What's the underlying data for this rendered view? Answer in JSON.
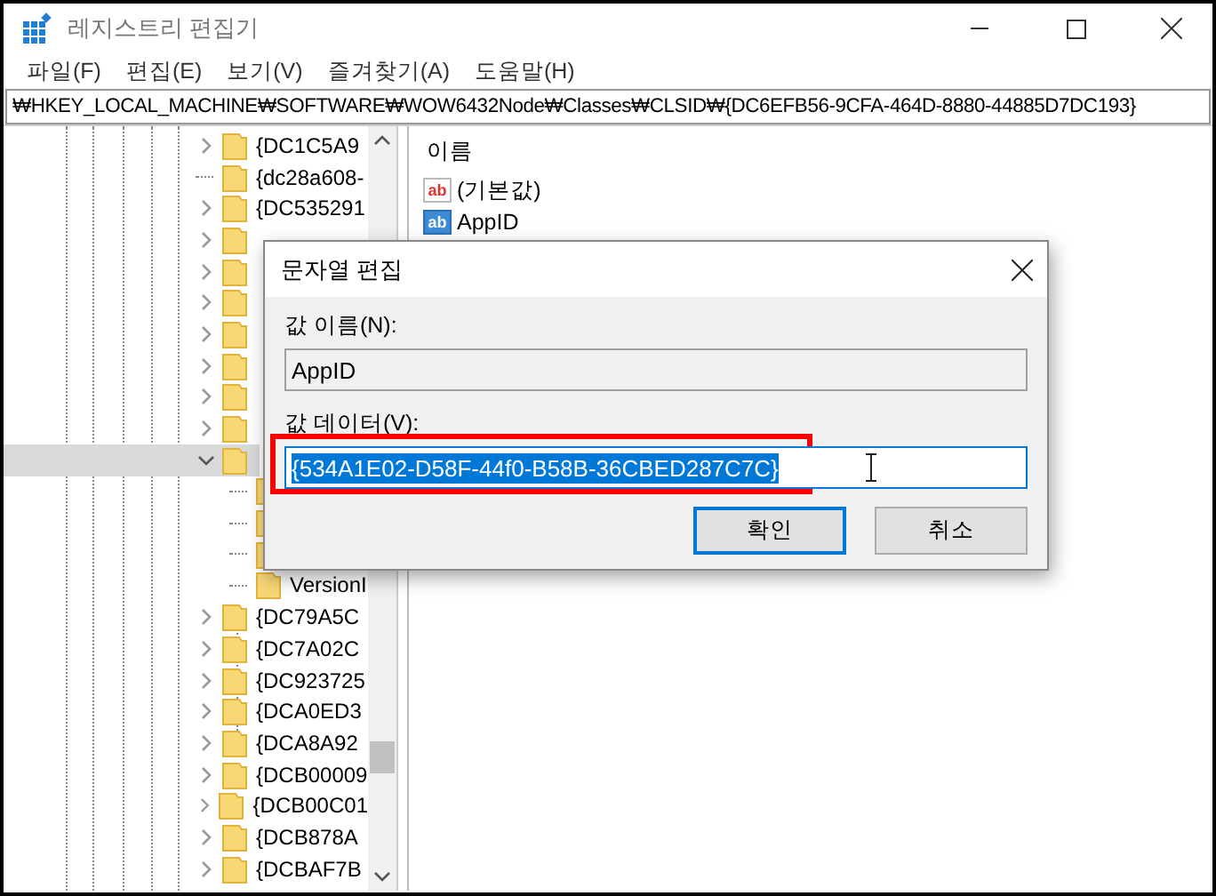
{
  "window": {
    "title": "레지스트리 편집기"
  },
  "menu": [
    "파일(F)",
    "편집(E)",
    "보기(V)",
    "즐겨찾기(A)",
    "도움말(H)"
  ],
  "address": "₩HKEY_LOCAL_MACHINE₩SOFTWARE₩WOW6432Node₩Classes₩CLSID₩{DC6EFB56-9CFA-464D-8880-44885D7DC193}",
  "tree": [
    {
      "label": "{DC1C5A9",
      "has_children": true,
      "expanded": false,
      "selected": false
    },
    {
      "label": "{dc28a608-",
      "has_children": false,
      "selected": false
    },
    {
      "label": "{DC535291",
      "has_children": true,
      "expanded": false,
      "selected": false
    },
    {
      "has_children": true,
      "expanded": false,
      "selected": false
    },
    {
      "has_children": true,
      "expanded": false,
      "selected": false
    },
    {
      "has_children": true,
      "expanded": false,
      "selected": false
    },
    {
      "has_children": true,
      "expanded": false,
      "selected": false
    },
    {
      "has_children": true,
      "expanded": false,
      "selected": false
    },
    {
      "has_children": true,
      "expanded": false,
      "selected": false
    },
    {
      "has_children": true,
      "expanded": false,
      "selected": false
    },
    {
      "has_children": true,
      "expanded": true,
      "selected": true,
      "children": [
        {
          "has_children": false,
          "selected": false
        },
        {
          "has_children": false,
          "selected": false
        },
        {
          "has_children": false,
          "selected": false
        },
        {
          "label": "VersionI",
          "has_children": false,
          "selected": false
        }
      ]
    },
    {
      "label": "{DC79A5C",
      "has_children": true,
      "expanded": false,
      "selected": false
    },
    {
      "label": "{DC7A02C",
      "has_children": true,
      "expanded": false,
      "selected": false
    },
    {
      "label": "{DC923725",
      "has_children": true,
      "expanded": false,
      "selected": false
    },
    {
      "label": "{DCA0ED3",
      "has_children": true,
      "expanded": false,
      "selected": false
    },
    {
      "label": "{DCA8A92",
      "has_children": true,
      "expanded": false,
      "selected": false
    },
    {
      "label": "{DCB00009",
      "has_children": true,
      "expanded": false,
      "selected": false
    },
    {
      "label": "{DCB00C01",
      "has_children": true,
      "expanded": false,
      "selected": false
    },
    {
      "label": "{DCB878A",
      "has_children": true,
      "expanded": false,
      "selected": false
    },
    {
      "label": "{DCBAF7B",
      "has_children": true,
      "expanded": false,
      "selected": false
    }
  ],
  "values": {
    "column": "이름",
    "rows": [
      {
        "icon": "ab",
        "name": "(기본값)",
        "selected": false
      },
      {
        "icon": "ab",
        "name": "AppID",
        "selected": true
      }
    ]
  },
  "dialog": {
    "title": "문자열 편집",
    "name_label": "값 이름(N):",
    "name_value": "AppID",
    "data_label": "값 데이터(V):",
    "data_value": "{534A1E02-D58F-44f0-B58B-36CBED287C7C}",
    "buttons": [
      {
        "label": "확인",
        "focused": true
      },
      {
        "label": "취소",
        "focused": false
      }
    ]
  }
}
